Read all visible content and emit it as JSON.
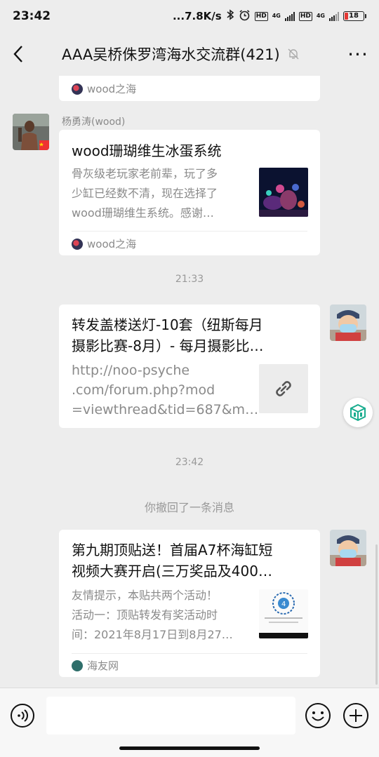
{
  "status_bar": {
    "time": "23:42",
    "net_speed": "...7.8K/s",
    "network_1": "4G",
    "network_2": "4G",
    "hd_1": "HD",
    "hd_2": "HD",
    "battery": "18",
    "battery_level_percent": 18,
    "battery_color": "#e53935",
    "icons": [
      "bluetooth-icon",
      "alarm-icon",
      "signal-icon",
      "battery-icon"
    ]
  },
  "header": {
    "title": "AAA吴桥侏罗湾海水交流群(421)",
    "back_icon": "back-arrow-icon",
    "mute_icon": "mute-bell-icon",
    "more_icon": "more-icon",
    "more_label": "···"
  },
  "messages": [
    {
      "type": "partial-card",
      "source": "wood之海"
    },
    {
      "type": "link-card",
      "sender": "杨勇涛(wood)",
      "title": "wood珊瑚维生冰蛋系统",
      "desc_lines": [
        "骨灰级老玩家老前辈，玩了多",
        "少缸已经数不清，现在选择了",
        "wood珊瑚维生系统。感谢…"
      ],
      "thumbnail": "coral-reef-photo",
      "source": "wood之海"
    },
    {
      "type": "time",
      "text": "21:33"
    },
    {
      "type": "link-card",
      "sender": "me",
      "title_lines": [
        "转发盖楼送灯-10套（纽斯每月",
        "摄影比赛-8月）- 每月摄影比…"
      ],
      "desc_lines": [
        "http://noo-psyche",
        ".com/forum.php?mod",
        "=viewthread&tid=687&m…"
      ],
      "thumbnail": "link-icon"
    },
    {
      "type": "time",
      "text": "23:42"
    },
    {
      "type": "system",
      "text": "你撤回了一条消息"
    },
    {
      "type": "link-card",
      "sender": "me",
      "title_lines": [
        "第九期顶贴送！首届A7杯海缸短",
        "视频大赛开启(三万奖品及400…"
      ],
      "desc_lines": [
        "友情提示，本贴共两个活动！",
        "活动一：顶贴转发有奖活动时",
        "间：2021年8月17日到8月27…"
      ],
      "thumbnail": "poster-image",
      "source": "海友网"
    }
  ],
  "input_bar": {
    "placeholder": "",
    "voice_icon": "voice-icon",
    "emoji_icon": "emoji-icon",
    "plus_icon": "plus-icon"
  },
  "floating_widget": {
    "icon": "mini-program-icon",
    "color": "#1aad8f"
  }
}
